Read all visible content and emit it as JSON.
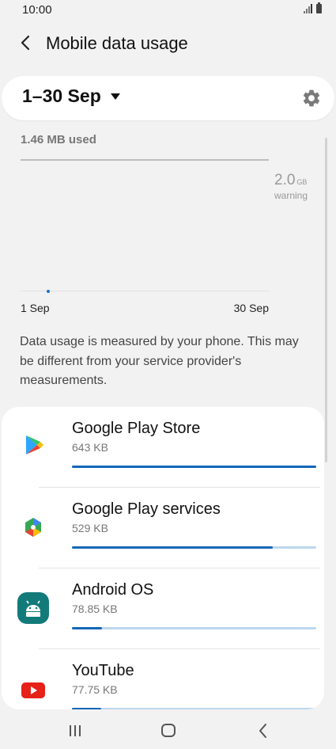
{
  "status_bar": {
    "time": "10:00"
  },
  "header": {
    "title": "Mobile data usage"
  },
  "period": {
    "label": "1–30 Sep"
  },
  "usage": {
    "used_label": "1.46 MB used",
    "warning_value": "2.0",
    "warning_unit": "GB",
    "warning_label": "warning",
    "x_start": "1 Sep",
    "x_end": "30 Sep"
  },
  "note": "Data usage is measured by your phone. This may be different from your service provider's measurements.",
  "apps": [
    {
      "name": "Google Play Store",
      "size": "643 KB",
      "fraction": 1.0,
      "icon": "google-play-store-icon"
    },
    {
      "name": "Google Play services",
      "size": "529 KB",
      "fraction": 0.823,
      "icon": "google-play-services-icon"
    },
    {
      "name": "Android OS",
      "size": "78.85 KB",
      "fraction": 0.123,
      "icon": "android-os-icon"
    },
    {
      "name": "YouTube",
      "size": "77.75 KB",
      "fraction": 0.121,
      "icon": "youtube-icon"
    }
  ],
  "colors": {
    "accent": "#1367b8",
    "track": "#bcd7ee",
    "background": "#f2f2f2"
  }
}
